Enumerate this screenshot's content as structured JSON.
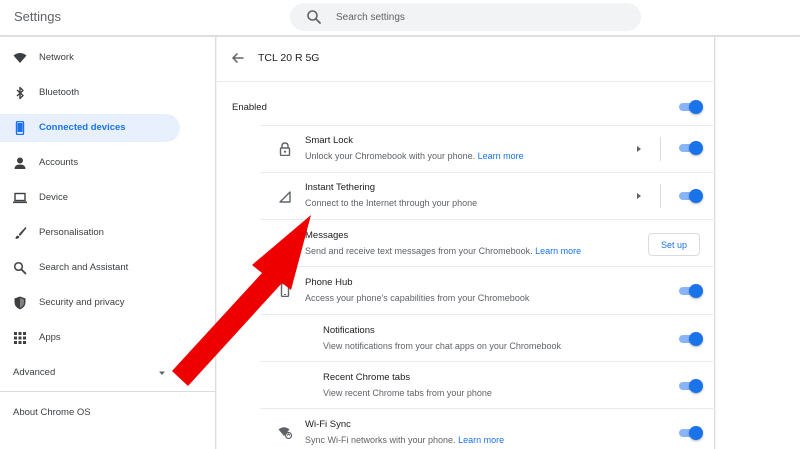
{
  "header": {
    "title": "Settings",
    "search_placeholder": "Search settings"
  },
  "sidebar": {
    "items": [
      {
        "label": "Network",
        "icon": "wifi-icon"
      },
      {
        "label": "Bluetooth",
        "icon": "bluetooth-icon"
      },
      {
        "label": "Connected devices",
        "icon": "phone-icon",
        "active": true
      },
      {
        "label": "Accounts",
        "icon": "person-icon"
      },
      {
        "label": "Device",
        "icon": "laptop-icon"
      },
      {
        "label": "Personalisation",
        "icon": "brush-icon"
      },
      {
        "label": "Search and Assistant",
        "icon": "search-icon"
      },
      {
        "label": "Security and privacy",
        "icon": "shield-icon"
      },
      {
        "label": "Apps",
        "icon": "apps-grid-icon"
      }
    ],
    "advanced_label": "Advanced",
    "about_label": "About Chrome OS"
  },
  "main": {
    "title": "TCL 20 R 5G",
    "enabled_label": "Enabled",
    "enabled_on": true,
    "features": [
      {
        "title": "Smart Lock",
        "subtitle": "Unlock your Chromebook with your phone.",
        "link": "Learn more",
        "icon": "lock-icon",
        "on": true
      },
      {
        "title": "Instant Tethering",
        "subtitle": "Connect to the Internet through your phone",
        "icon": "signal-icon",
        "on": true
      },
      {
        "title": "Messages",
        "subtitle": "Send and receive text messages from your Chromebook.",
        "link": "Learn more",
        "icon": "messages-icon",
        "button": "Set up"
      },
      {
        "title": "Phone Hub",
        "subtitle": "Access your phone's capabilities from your Chromebook",
        "icon": "phone-icon",
        "on": true
      },
      {
        "title": "Notifications",
        "subtitle": "View notifications from your chat apps on your Chromebook",
        "on": true
      },
      {
        "title": "Recent Chrome tabs",
        "subtitle": "View recent Chrome tabs from your phone",
        "on": true
      },
      {
        "title": "Wi-Fi Sync",
        "subtitle": "Sync Wi-Fi networks with your phone.",
        "link": "Learn more",
        "icon": "wifi-sync-icon",
        "on": true
      }
    ]
  },
  "colors": {
    "accent": "#1a73e8",
    "toggle_track": "#8ab4f8",
    "annotation_arrow": "#ee0000",
    "active_nav_bg": "#e8f0fe"
  }
}
